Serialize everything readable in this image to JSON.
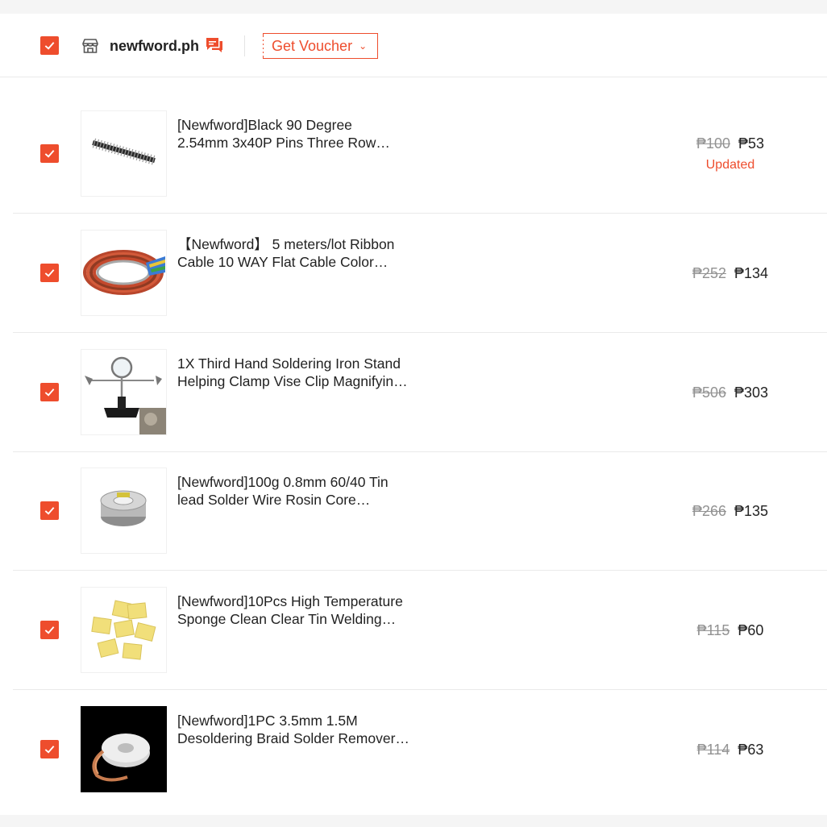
{
  "shop": {
    "name": "newfword.ph",
    "voucher_label": "Get Voucher"
  },
  "colors": {
    "accent": "#ee4d2d",
    "muted": "#929292"
  },
  "items": [
    {
      "title_line1": "[Newfword]Black 90 Degree",
      "title_line2": "2.54mm 3x40P Pins Three Row…",
      "orig_price": "₱100",
      "price": "₱53",
      "status": "Updated",
      "checked": true
    },
    {
      "title_line1": "【Newfword】 5 meters/lot Ribbon",
      "title_line2": "Cable 10 WAY Flat Cable Color…",
      "orig_price": "₱252",
      "price": "₱134",
      "checked": true
    },
    {
      "title_line1": "1X Third Hand Soldering Iron Stand",
      "title_line2": "Helping Clamp Vise Clip Magnifyin…",
      "orig_price": "₱506",
      "price": "₱303",
      "checked": true
    },
    {
      "title_line1": "[Newfword]100g 0.8mm 60/40 Tin",
      "title_line2": "lead Solder Wire Rosin Core…",
      "orig_price": "₱266",
      "price": "₱135",
      "checked": true
    },
    {
      "title_line1": "[Newfword]10Pcs High Temperature",
      "title_line2": "Sponge Clean Clear Tin Welding…",
      "orig_price": "₱115",
      "price": "₱60",
      "checked": true
    },
    {
      "title_line1": "[Newfword]1PC 3.5mm 1.5M",
      "title_line2": "Desoldering Braid Solder Remover…",
      "orig_price": "₱114",
      "price": "₱63",
      "checked": true
    }
  ]
}
